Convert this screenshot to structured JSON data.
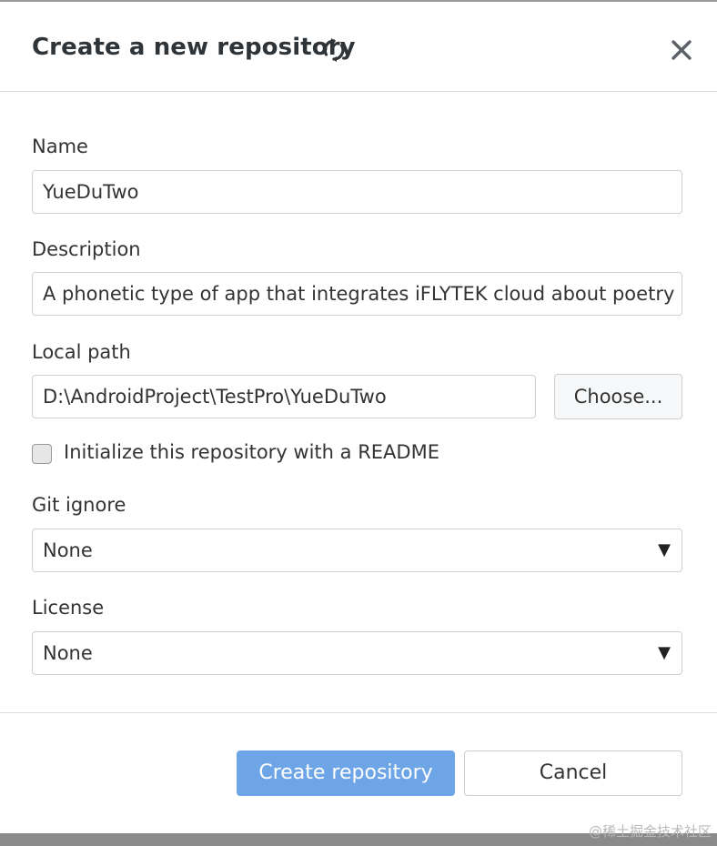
{
  "dialog": {
    "title": "Create a new repository",
    "icons": {
      "loading": "sync-spinner-icon",
      "close": "close-icon"
    }
  },
  "form": {
    "name": {
      "label": "Name",
      "value": "YueDuTwo"
    },
    "description": {
      "label": "Description",
      "value": "A phonetic type of app that integrates iFLYTEK cloud about poetry"
    },
    "local_path": {
      "label": "Local path",
      "value": "D:\\AndroidProject\\TestPro\\YueDuTwo",
      "choose_label": "Choose..."
    },
    "readme": {
      "label": "Initialize this repository with a README",
      "checked": false
    },
    "git_ignore": {
      "label": "Git ignore",
      "selected": "None"
    },
    "license": {
      "label": "License",
      "selected": "None"
    }
  },
  "footer": {
    "create_label": "Create repository",
    "cancel_label": "Cancel"
  },
  "colors": {
    "primary_button": "#6ea5e6",
    "title_text": "#2f3438",
    "border": "#cfcfcf"
  },
  "watermark": "@稀土掘金技术社区"
}
